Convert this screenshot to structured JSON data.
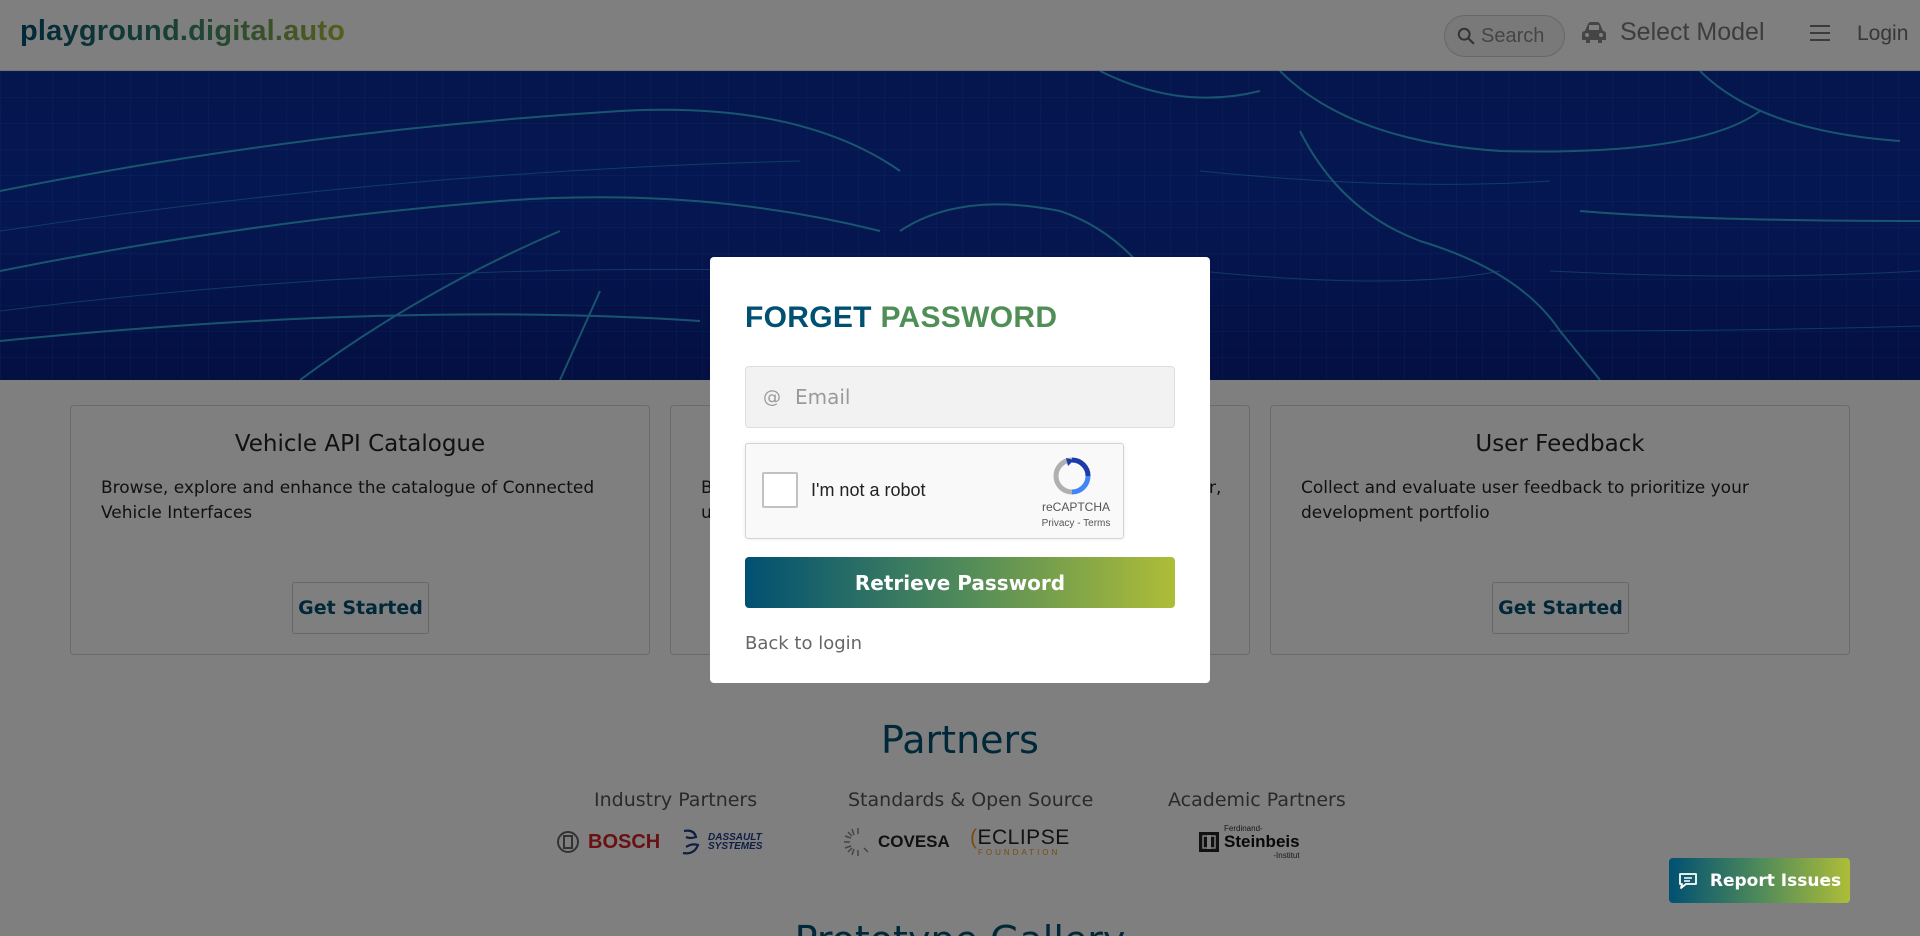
{
  "header": {
    "logo": "playground.digital.auto",
    "search_placeholder": "Search",
    "select_model": "Select Model",
    "login": "Login"
  },
  "cards": [
    {
      "title": "Vehicle API Catalogue",
      "description": "Browse, explore and enhance the catalogue of Connected Vehicle Interfaces",
      "button": "Get Started"
    },
    {
      "title": "",
      "description_fragment_1": "B",
      "description_fragment_2": "u",
      "description_fragment_3": "r,",
      "button": ""
    },
    {
      "title": "User Feedback",
      "description": "Collect and evaluate user feedback to prioritize your development portfolio",
      "button": "Get Started"
    }
  ],
  "partners": {
    "title": "Partners",
    "categories": [
      {
        "name": "Industry Partners",
        "logos": [
          "BOSCH",
          "DASSAULT SYSTEMES"
        ]
      },
      {
        "name": "Standards & Open Source",
        "logos": [
          "COVESA",
          "ECLIPSE",
          "FOUNDATION"
        ]
      },
      {
        "name": "Academic Partners",
        "logos": [
          "Ferdinand-",
          "Steinbeis",
          "-Institut"
        ]
      }
    ],
    "next_section_title": "Prototype Gallery"
  },
  "modal": {
    "title_part1": "FORGET",
    "title_part2": "PASSWORD",
    "email_placeholder": "Email",
    "captcha_label": "I'm not a robot",
    "captcha_brand": "reCAPTCHA",
    "captcha_links": "Privacy - Terms",
    "retrieve_button": "Retrieve Password",
    "back_link": "Back to login"
  },
  "report_issues": "Report Issues",
  "colors": {
    "primary": "#005072",
    "accent": "#aebd38",
    "overlay": "rgba(0,0,0,0.5)"
  }
}
